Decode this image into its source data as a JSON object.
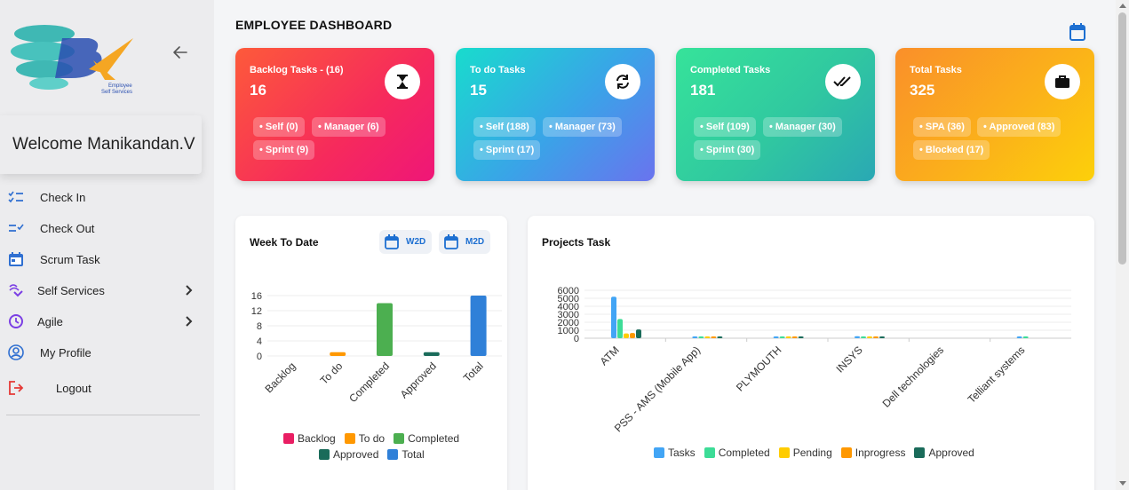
{
  "sidebar": {
    "logo_text": [
      "Employee",
      "Self Services"
    ],
    "welcome": "Welcome Manikandan.V",
    "items": [
      {
        "label": "Check In",
        "icon": "checklist-icon"
      },
      {
        "label": "Check Out",
        "icon": "checkout-icon"
      },
      {
        "label": "Scrum Task",
        "icon": "calendar-icon"
      },
      {
        "label": "Self Services",
        "icon": "self-service-icon"
      },
      {
        "label": "Agile",
        "icon": "agile-icon"
      },
      {
        "label": "My Profile",
        "icon": "profile-icon"
      },
      {
        "label": "Logout",
        "icon": "logout-icon"
      }
    ]
  },
  "header": {
    "title": "EMPLOYEE DASHBOARD"
  },
  "cards": [
    {
      "title": "Backlog Tasks - (16)",
      "value": "16",
      "icon": "hourglass-icon",
      "chips": [
        "• Self (0)",
        "• Manager (6)",
        "• Sprint (9)"
      ]
    },
    {
      "title": "To do Tasks",
      "value": "15",
      "icon": "refresh-icon",
      "chips": [
        "• Self (188)",
        "• Manager (73)",
        "• Sprint (17)"
      ]
    },
    {
      "title": "Completed Tasks",
      "value": "181",
      "icon": "double-check-icon",
      "chips": [
        "• Self (109)",
        "• Manager (30)",
        "• Sprint (30)"
      ]
    },
    {
      "title": "Total Tasks",
      "value": "325",
      "icon": "briefcase-icon",
      "chips": [
        "• SPA (36)",
        "• Approved (83)",
        "• Blocked (17)"
      ]
    }
  ],
  "week_panel": {
    "title": "Week To Date",
    "btn_w2d": "W2D",
    "btn_m2d": "M2D"
  },
  "projects_panel": {
    "title": "Projects Task"
  },
  "colors": {
    "backlog": "#e91e63",
    "todo": "#ff9800",
    "completed": "#4caf50",
    "approved": "#1a6b5a",
    "total": "#2f80d8",
    "tasks": "#42a5f5",
    "proj_completed": "#3ddc97",
    "pending": "#ffcc00",
    "inprogress": "#ff9800",
    "proj_approved": "#1a6b5a"
  },
  "chart_data": [
    {
      "type": "bar",
      "categories": [
        "Backlog",
        "To do",
        "Completed",
        "Approved",
        "Total"
      ],
      "values": [
        0,
        1,
        14,
        1,
        16
      ],
      "ylim": [
        0,
        16
      ],
      "yticks": [
        0,
        4,
        8,
        12,
        16
      ],
      "legend": [
        "Backlog",
        "To do",
        "Completed",
        "Approved",
        "Total"
      ],
      "legend_position": "bottom"
    },
    {
      "type": "bar",
      "categories": [
        "ATM",
        "PSS - AMS (Mobile App)",
        "PLYMOUTH",
        "INSYS",
        "Dell technologies",
        "Telliant systems"
      ],
      "series": [
        {
          "name": "Tasks",
          "values": [
            5200,
            150,
            200,
            250,
            0,
            20
          ]
        },
        {
          "name": "Completed",
          "values": [
            2400,
            100,
            150,
            200,
            0,
            10
          ]
        },
        {
          "name": "Pending",
          "values": [
            600,
            20,
            30,
            30,
            0,
            0
          ]
        },
        {
          "name": "Inprogress",
          "values": [
            650,
            30,
            40,
            30,
            0,
            0
          ]
        },
        {
          "name": "Approved",
          "values": [
            1100,
            50,
            60,
            40,
            0,
            0
          ]
        }
      ],
      "ylim": [
        0,
        6000
      ],
      "yticks": [
        0,
        1000,
        2000,
        3000,
        4000,
        5000,
        6000
      ],
      "legend_position": "bottom"
    }
  ]
}
